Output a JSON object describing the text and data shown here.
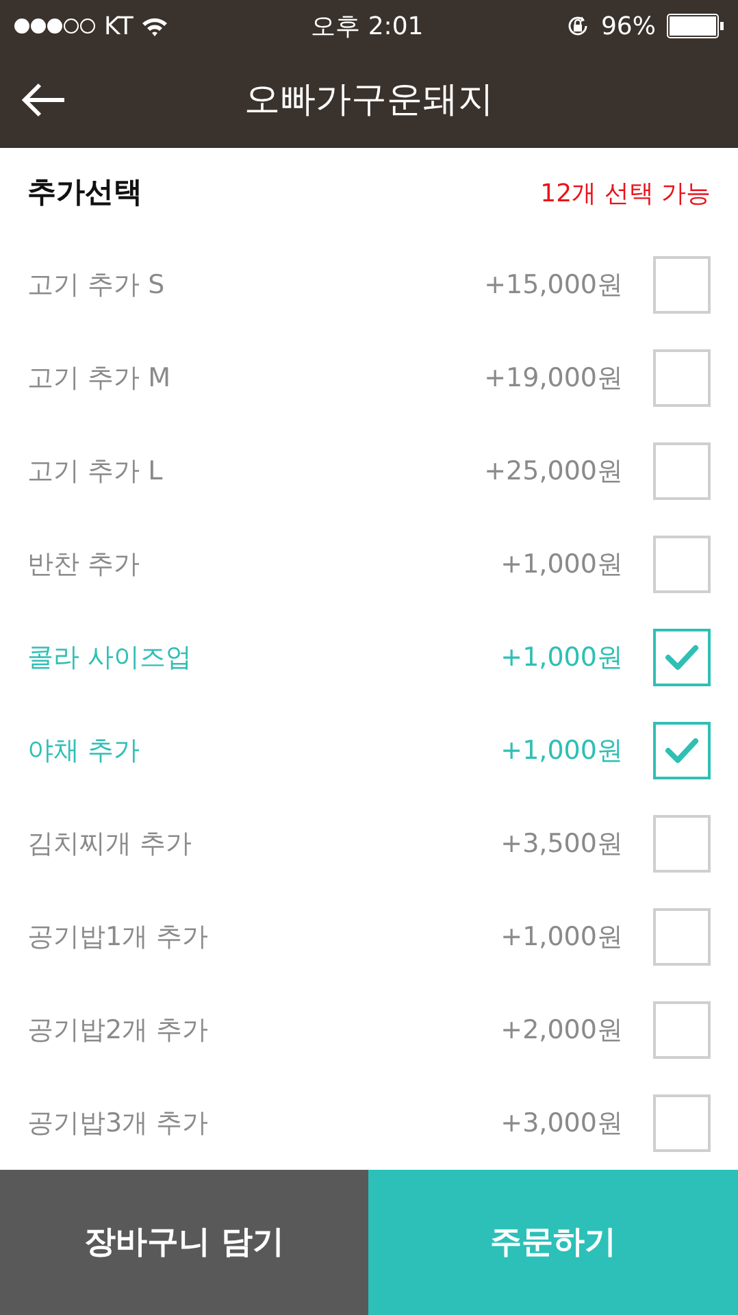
{
  "status_bar": {
    "carrier": "KT",
    "time": "오후 2:01",
    "battery": "96%"
  },
  "nav": {
    "title": "오빠가구운돼지"
  },
  "section": {
    "title": "추가선택",
    "limit": "12개 선택 가능"
  },
  "options": [
    {
      "name": "고기 추가 S",
      "price": "+15,000원",
      "checked": false
    },
    {
      "name": "고기 추가 M",
      "price": "+19,000원",
      "checked": false
    },
    {
      "name": "고기 추가 L",
      "price": "+25,000원",
      "checked": false
    },
    {
      "name": "반찬 추가",
      "price": "+1,000원",
      "checked": false
    },
    {
      "name": "콜라 사이즈업",
      "price": "+1,000원",
      "checked": true
    },
    {
      "name": "야채 추가",
      "price": "+1,000원",
      "checked": true
    },
    {
      "name": "김치찌개 추가",
      "price": "+3,500원",
      "checked": false
    },
    {
      "name": "공기밥1개 추가",
      "price": "+1,000원",
      "checked": false
    },
    {
      "name": "공기밥2개 추가",
      "price": "+2,000원",
      "checked": false
    },
    {
      "name": "공기밥3개 추가",
      "price": "+3,000원",
      "checked": false
    }
  ],
  "buttons": {
    "cart": "장바구니 담기",
    "order": "주문하기"
  }
}
